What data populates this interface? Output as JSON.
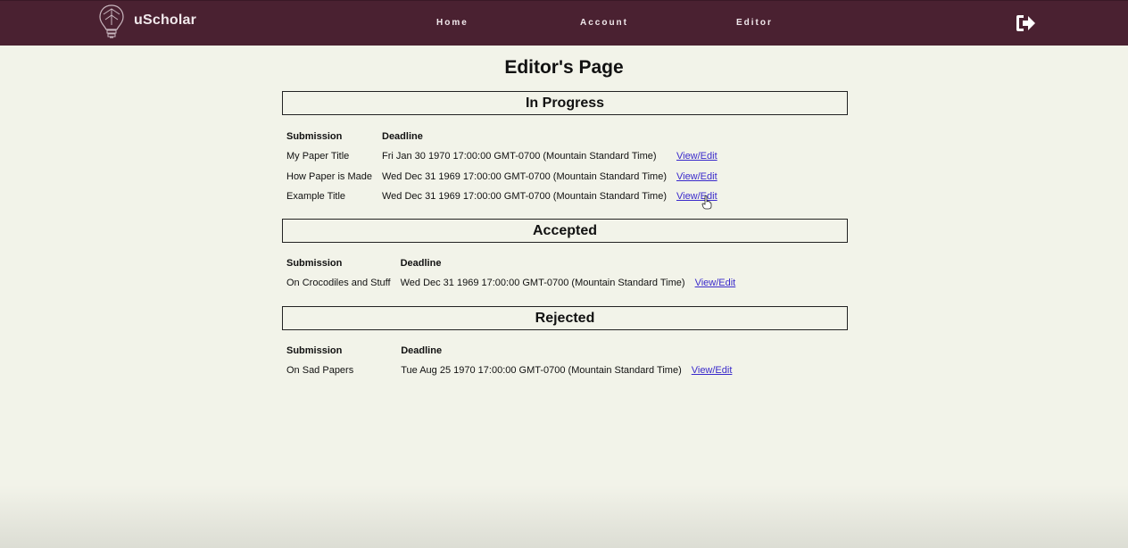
{
  "brand": {
    "name": "uScholar"
  },
  "nav": {
    "home": "Home",
    "account": "Account",
    "editor": "Editor"
  },
  "page": {
    "title": "Editor's Page"
  },
  "columns": {
    "submission": "Submission",
    "deadline": "Deadline"
  },
  "action_label": "View/Edit",
  "sections": {
    "in_progress": {
      "title": "In Progress",
      "rows": [
        {
          "submission": "My Paper Title",
          "deadline": "Fri Jan 30 1970 17:00:00 GMT-0700 (Mountain Standard Time)"
        },
        {
          "submission": "How Paper is Made",
          "deadline": "Wed Dec 31 1969 17:00:00 GMT-0700 (Mountain Standard Time)"
        },
        {
          "submission": "Example Title",
          "deadline": "Wed Dec 31 1969 17:00:00 GMT-0700 (Mountain Standard Time)"
        }
      ]
    },
    "accepted": {
      "title": "Accepted",
      "rows": [
        {
          "submission": "On Crocodiles and Stuff",
          "deadline": "Wed Dec 31 1969 17:00:00 GMT-0700 (Mountain Standard Time)"
        }
      ]
    },
    "rejected": {
      "title": "Rejected",
      "rows": [
        {
          "submission": "On Sad Papers",
          "deadline": "Tue Aug 25 1970 17:00:00 GMT-0700 (Mountain Standard Time)"
        }
      ]
    }
  },
  "colors": {
    "header": "#4a2131",
    "background": "#f2f3e9",
    "link": "#3a2acb"
  },
  "icons": {
    "logo": "lightbulb-logo-icon",
    "logout": "sign-out-icon"
  }
}
